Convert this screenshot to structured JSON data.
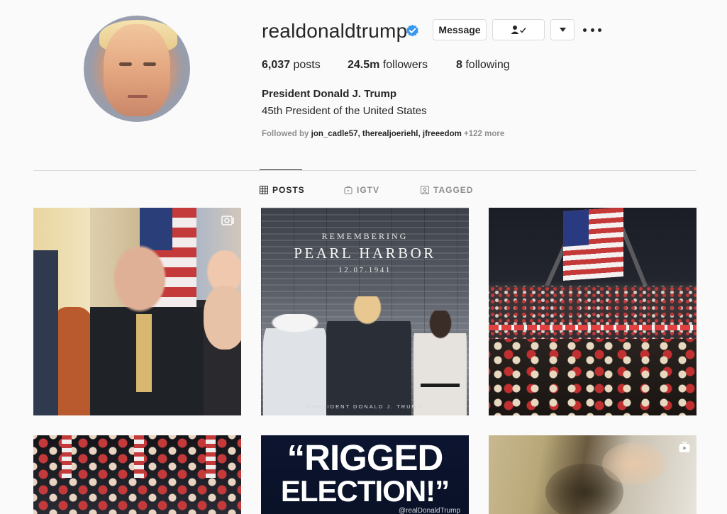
{
  "profile": {
    "username": "realdonaldtrump",
    "verified": true,
    "message_label": "Message",
    "stats": {
      "posts_count": "6,037",
      "posts_label": "posts",
      "followers_count": "24.5m",
      "followers_label": "followers",
      "following_count": "8",
      "following_label": "following"
    },
    "full_name": "President Donald J. Trump",
    "bio": "45th President of the United States",
    "followed_by_prefix": "Followed by ",
    "followed_by_names": "jon_cadle57, therealjoeriehl, jfreeedom",
    "followed_by_more": " +122 more"
  },
  "tabs": [
    {
      "label": "POSTS",
      "icon": "grid-icon",
      "active": true
    },
    {
      "label": "IGTV",
      "icon": "igtv-icon",
      "active": false
    },
    {
      "label": "TAGGED",
      "icon": "tagged-icon",
      "active": false
    }
  ],
  "posts": {
    "p2": {
      "line1": "REMEMBERING",
      "line2": "PEARL HARBOR",
      "line3": "12.07.1941",
      "signature": "PRESIDENT DONALD J. TRUMP"
    },
    "p5": {
      "line1": "“RIGGED",
      "line2": "ELECTION!”",
      "handle": "@realDonaldTrump"
    }
  },
  "colors": {
    "accent": "#3897f0",
    "text": "#262626",
    "muted": "#8e8e8e",
    "border": "#dbdbdb",
    "background": "#fafafa"
  }
}
